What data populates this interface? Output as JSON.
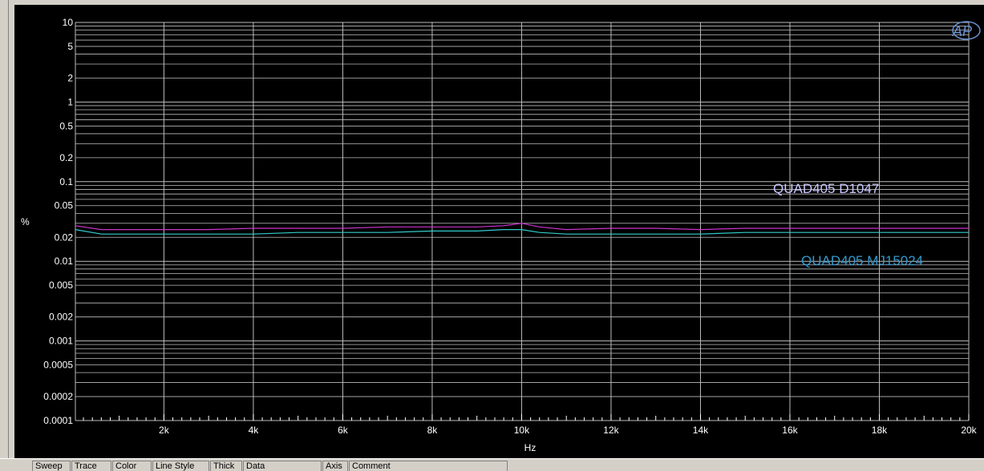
{
  "chart_data": {
    "type": "line",
    "xlabel": "Hz",
    "ylabel": "%",
    "xlim": [
      20,
      20000
    ],
    "ylim": [
      0.0001,
      10
    ],
    "y_scale": "log",
    "x_scale": "linear",
    "grid": true,
    "x_ticks": [
      {
        "value": 2000,
        "label": "2k"
      },
      {
        "value": 4000,
        "label": "4k"
      },
      {
        "value": 6000,
        "label": "6k"
      },
      {
        "value": 8000,
        "label": "8k"
      },
      {
        "value": 10000,
        "label": "10k"
      },
      {
        "value": 12000,
        "label": "12k"
      },
      {
        "value": 14000,
        "label": "14k"
      },
      {
        "value": 16000,
        "label": "16k"
      },
      {
        "value": 18000,
        "label": "18k"
      },
      {
        "value": 20000,
        "label": "20k"
      }
    ],
    "y_ticks": [
      {
        "value": 10,
        "label": "10"
      },
      {
        "value": 5,
        "label": "5"
      },
      {
        "value": 2,
        "label": "2"
      },
      {
        "value": 1,
        "label": "1"
      },
      {
        "value": 0.5,
        "label": "0.5"
      },
      {
        "value": 0.2,
        "label": "0.2"
      },
      {
        "value": 0.1,
        "label": "0.1"
      },
      {
        "value": 0.05,
        "label": "0.05"
      },
      {
        "value": 0.02,
        "label": "0.02"
      },
      {
        "value": 0.01,
        "label": "0.01"
      },
      {
        "value": 0.005,
        "label": "0.005"
      },
      {
        "value": 0.002,
        "label": "0.002"
      },
      {
        "value": 0.001,
        "label": "0.001"
      },
      {
        "value": 0.0005,
        "label": "0.0005"
      },
      {
        "value": 0.0002,
        "label": "0.0002"
      },
      {
        "value": 0.0001,
        "label": "0.0001"
      }
    ],
    "series": [
      {
        "name": "QUAD405 D1047",
        "color": "#cc33cc",
        "label_color": "#c8c8ff",
        "x": [
          20,
          600,
          1000,
          2000,
          3000,
          4000,
          5000,
          6000,
          7000,
          8000,
          9000,
          9600,
          10000,
          10400,
          11000,
          12000,
          13000,
          14000,
          15000,
          16000,
          17000,
          18000,
          19000,
          20000
        ],
        "y": [
          0.028,
          0.025,
          0.025,
          0.025,
          0.025,
          0.026,
          0.026,
          0.026,
          0.027,
          0.027,
          0.027,
          0.028,
          0.03,
          0.027,
          0.025,
          0.026,
          0.026,
          0.025,
          0.026,
          0.026,
          0.026,
          0.026,
          0.026,
          0.026
        ]
      },
      {
        "name": "QUAD405 MJ15024",
        "color": "#33cccc",
        "label_color": "#3399cc",
        "x": [
          20,
          600,
          1000,
          2000,
          3000,
          4000,
          5000,
          6000,
          7000,
          8000,
          9000,
          9600,
          10000,
          10400,
          11000,
          12000,
          13000,
          14000,
          15000,
          16000,
          17000,
          18000,
          19000,
          20000
        ],
        "y": [
          0.025,
          0.022,
          0.022,
          0.022,
          0.022,
          0.022,
          0.023,
          0.023,
          0.023,
          0.024,
          0.024,
          0.025,
          0.025,
          0.023,
          0.022,
          0.022,
          0.022,
          0.022,
          0.023,
          0.023,
          0.023,
          0.023,
          0.023,
          0.023
        ]
      }
    ],
    "logo": "AP"
  },
  "table_headers": [
    "Sweep",
    "Trace",
    "Color",
    "Line Style",
    "Thick",
    "Data",
    "Axis",
    "Comment"
  ]
}
